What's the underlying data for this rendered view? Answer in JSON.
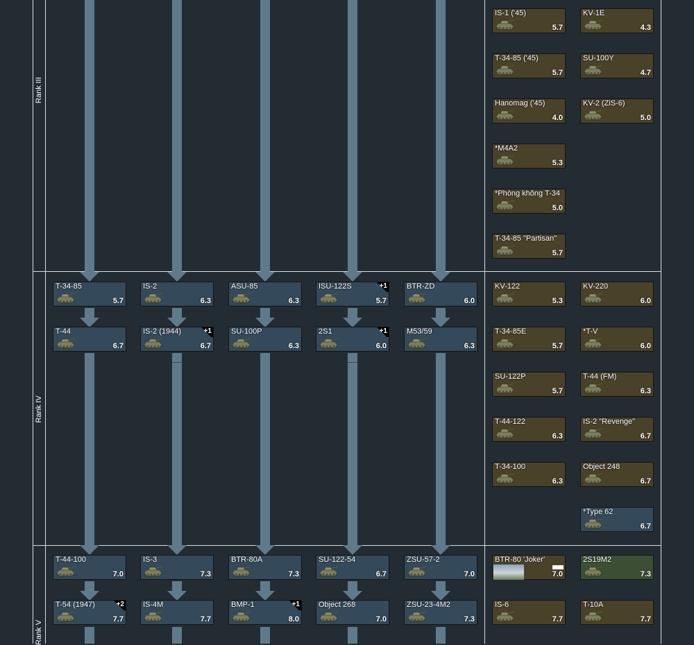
{
  "ranks": [
    {
      "label": "Rank III"
    },
    {
      "label": "Rank IV"
    },
    {
      "label": "Rank V"
    }
  ],
  "colors": {
    "background": "#242c33",
    "track": "#5f7b8b",
    "tree_card": "#34495a",
    "premium_card": "#4a4129",
    "event_card": "#3c4e33"
  },
  "rank3_premium": [
    {
      "name": "IS-1 ('45)",
      "br": "5.7"
    },
    {
      "name": "KV-1E",
      "br": "4.3"
    },
    {
      "name": "T-34-85 ('45)",
      "br": "5.7"
    },
    {
      "name": "SU-100Y",
      "br": "4.7"
    },
    {
      "name": "Hanomag ('45)",
      "br": "4.0"
    },
    {
      "name": "KV-2 (ZiS-6)",
      "br": "5.0"
    },
    {
      "name": "*M4A2",
      "br": "5.3"
    },
    {
      "name": "*Phòng không T-34",
      "br": "5.0"
    },
    {
      "name": "T-34-85 \"Partisan\"",
      "br": "5.7"
    }
  ],
  "rank4_tree": [
    {
      "name": "T-34-85",
      "br": "5.7"
    },
    {
      "name": "IS-2",
      "br": "6.3"
    },
    {
      "name": "ASU-85",
      "br": "6.3"
    },
    {
      "name": "ISU-122S",
      "br": "5.7",
      "badge": "+1"
    },
    {
      "name": "BTR-ZD",
      "br": "6.0"
    },
    {
      "name": "T-44",
      "br": "6.7"
    },
    {
      "name": "IS-2 (1944)",
      "br": "6.7",
      "badge": "+1"
    },
    {
      "name": "SU-100P",
      "br": "6.3"
    },
    {
      "name": "2S1",
      "br": "6.0",
      "badge": "+1"
    },
    {
      "name": "M53/59",
      "br": "6.3"
    }
  ],
  "rank4_premium": [
    {
      "name": "KV-122",
      "br": "5.3"
    },
    {
      "name": "KV-220",
      "br": "6.0"
    },
    {
      "name": "T-34-85E",
      "br": "5.7"
    },
    {
      "name": "*T-V",
      "br": "6.0"
    },
    {
      "name": "SU-122P",
      "br": "5.7"
    },
    {
      "name": "T-44 (FM)",
      "br": "6.3"
    },
    {
      "name": "T-44-122",
      "br": "6.3"
    },
    {
      "name": "IS-2 \"Revenge\"",
      "br": "6.7"
    },
    {
      "name": "T-34-100",
      "br": "6.3"
    },
    {
      "name": "Object 248",
      "br": "6.7"
    },
    {
      "name": "*Type 62",
      "br": "6.7"
    }
  ],
  "rank5_tree": [
    {
      "name": "T-44-100",
      "br": "7.0"
    },
    {
      "name": "IS-3",
      "br": "7.3"
    },
    {
      "name": "BTR-80A",
      "br": "7.3"
    },
    {
      "name": "SU-122-54",
      "br": "6.7"
    },
    {
      "name": "ZSU-57-2",
      "br": "7.0"
    },
    {
      "name": "T-54 (1947)",
      "br": "7.7",
      "badge": "+2"
    },
    {
      "name": "IS-4M",
      "br": "7.7"
    },
    {
      "name": "BMP-1",
      "br": "8.0",
      "badge": "+1"
    },
    {
      "name": "Object 268",
      "br": "7.0"
    },
    {
      "name": "ZSU-23-4M2",
      "br": "7.3"
    }
  ],
  "rank5_premium": [
    {
      "name": "BTR-80 'Joker'",
      "br": "7.0"
    },
    {
      "name": "2S19M2",
      "br": "7.3"
    },
    {
      "name": "IS-6",
      "br": "7.7"
    },
    {
      "name": "T-10A",
      "br": "7.7"
    }
  ]
}
